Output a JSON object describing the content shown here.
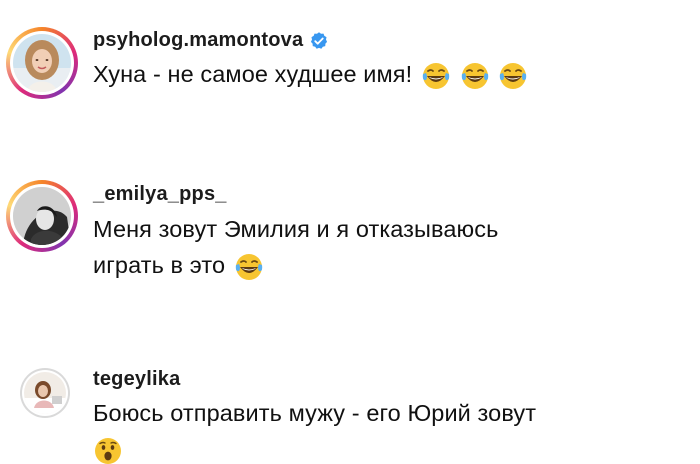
{
  "comments": [
    {
      "username": "psyholog.mamontova",
      "verified": true,
      "text": "Хуна - не самое худшее имя!",
      "emojis": [
        "tears-of-joy-emoji",
        "tears-of-joy-emoji",
        "tears-of-joy-emoji"
      ]
    },
    {
      "username": "_emilya_pps_",
      "verified": false,
      "text_line1": "Меня зовут Эмилия и я отказываюсь",
      "text_line2": "играть в это",
      "emojis": [
        "tears-of-joy-emoji"
      ]
    },
    {
      "username": "tegeylika",
      "verified": false,
      "text": "Боюсь отправить мужу - его Юрий зовут",
      "emojis": [
        "astonished-face-emoji"
      ]
    }
  ],
  "colors": {
    "verified_badge": "#3897f0",
    "story_ring": "#dd2a7b",
    "text": "#111111",
    "emoji_face": "#f7c531"
  }
}
